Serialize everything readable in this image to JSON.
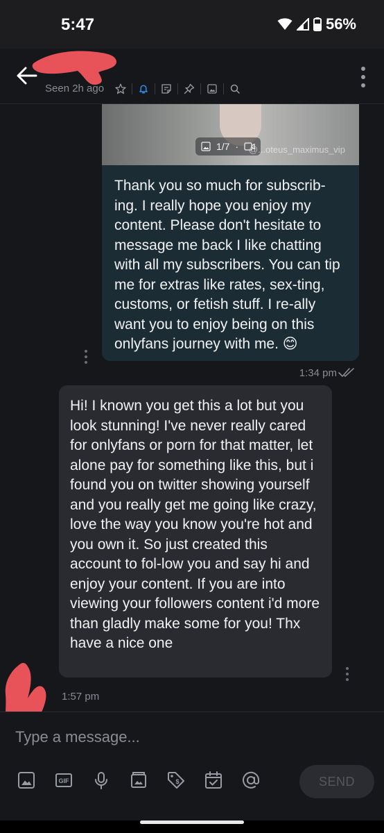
{
  "status_bar": {
    "time": "5:47",
    "battery": "56%"
  },
  "header": {
    "contact_name": "",
    "seen": "Seen 2h ago",
    "icons": [
      "star-icon",
      "bell-icon",
      "note-icon",
      "pin-icon",
      "image-icon",
      "search-icon"
    ],
    "menu_icon": "more-vert-icon"
  },
  "messages": [
    {
      "direction": "outgoing",
      "media": {
        "counter": "1/7",
        "watermark": "@...oteus_maximus_vip"
      },
      "text": "Thank you so much for subscrib-ing. I really hope you enjoy my content. Please don't hesitate to message me back I like chatting with all my subscribers. You can tip me for extras like rates, sex-ting, customs, or fetish stuff. I re-ally want you to enjoy being on this onlyfans journey with me. 😊",
      "time": "1:34 pm",
      "read": true
    },
    {
      "direction": "incoming",
      "text": "Hi! I known you get this a lot but you look stunning! I've never really cared for onlyfans or porn for that matter, let alone pay for something like this, but i found you on twitter showing yourself and you really get me going like crazy, love the way you know you're hot and you own it. So just created this account to fol-low you and say hi and enjoy your content. If you are into viewing your followers content i'd more than gladly make some for you! Thx have a nice one",
      "time": "1:57 pm"
    }
  ],
  "composer": {
    "placeholder": "Type a message...",
    "send_label": "SEND",
    "tools": [
      "image-icon",
      "gif-icon",
      "mic-icon",
      "vault-icon",
      "price-tag-icon",
      "calendar-icon",
      "at-icon"
    ]
  },
  "colors": {
    "background": "#16171b",
    "outgoing_bubble": "#1c2c35",
    "incoming_bubble": "#2a2b30",
    "accent": "#2d8ef0",
    "redaction": "#e8535a"
  }
}
